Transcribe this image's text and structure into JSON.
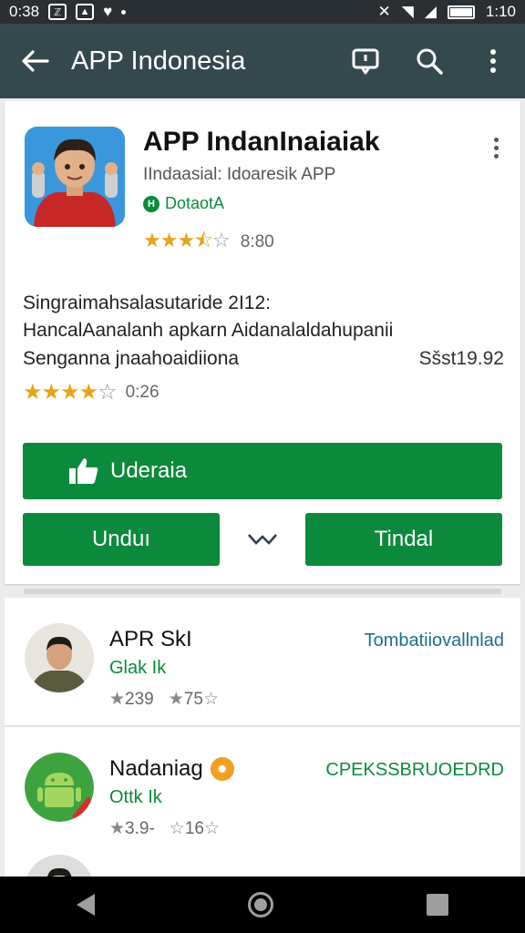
{
  "status_bar": {
    "time_left": "0:38",
    "time_right": "1:10"
  },
  "app_bar": {
    "title": "APP Indonesia",
    "icons": [
      "arrow-back-icon",
      "feedback-icon",
      "search-icon",
      "more-vert-icon"
    ]
  },
  "app": {
    "name": "APP IndanInaiaiak",
    "developer": "IIndaasial: Idoaresik APP",
    "badge": "DotaotA",
    "rating_stars": 3.5,
    "rating_count": "8:80"
  },
  "description": {
    "line1": "Singraimahsalasutaride 2I12:",
    "line2": "HancalAanalanh apkarn Aidanalaldahupanii",
    "line3": "Senganna jnaahoaidiiona",
    "price": "Sšst19.92",
    "rating_stars": 4,
    "rating_count": "0:26"
  },
  "buttons": {
    "main_label": "Uderaia",
    "left_label": "Unduı",
    "right_label": "Tindal"
  },
  "list": [
    {
      "name": "APR SkI",
      "subtitle": "Glak Ik",
      "stat1": "239",
      "stat2": "75",
      "link": "Tombatiiovallnlad",
      "link_color": "#1f6f8b"
    },
    {
      "name": "Nadaniag",
      "subtitle": "Ottk Ik",
      "stat1": "3.9-",
      "stat2": "16",
      "link": "CPEKSSBRUOEDRD",
      "link_color": "#0b8a3c"
    }
  ],
  "colors": {
    "app_bar": "#34494d",
    "green": "#0b8a3c",
    "star": "#e8a317"
  }
}
